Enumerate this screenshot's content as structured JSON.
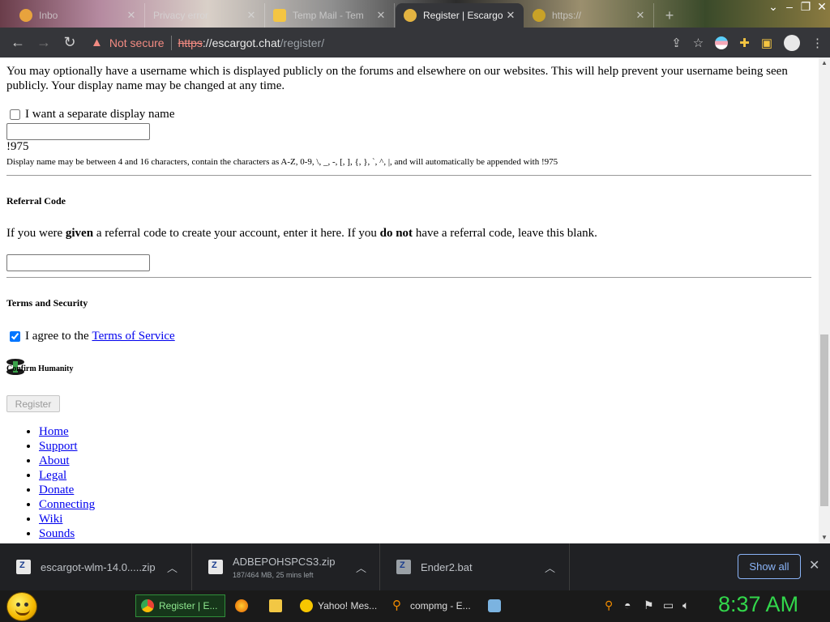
{
  "browser": {
    "tabs": [
      {
        "title": "Inbo"
      },
      {
        "title": "Privacy error"
      },
      {
        "title": "Temp Mail - Tem"
      },
      {
        "title": "Register | Escargo"
      },
      {
        "title": "https://"
      }
    ],
    "security_label": "Not secure",
    "url": {
      "scheme": "https",
      "host": "://escargot.chat",
      "path": "/register/"
    }
  },
  "page": {
    "intro": "You may optionally have a username which is displayed publicly on the forums and elsewhere on our websites. This will help prevent your username being seen publicly. Your display name may be changed at any time.",
    "display_name_checkbox": "I want a separate display name",
    "display_name_suffix": "!975",
    "display_name_hint": "Display name may be between 4 and 16 characters, contain the characters as A-Z, 0-9, \\, _, -, [, ], {, }, `, ^, |, and will automatically be appended with !975",
    "referral_heading": "Referral Code",
    "referral_text": {
      "a": "If you were ",
      "b": "given",
      "c": " a referral code to create your account, enter it here. If you ",
      "d": "do not",
      "e": " have a referral code, leave this blank."
    },
    "terms_heading": "Terms and Security",
    "agree_prefix": "I agree to the ",
    "terms_link": "Terms of Service",
    "terms_checked": true,
    "captcha_heading": "Confirm Humanity",
    "register_button": "Register",
    "footer_links": [
      "Home",
      "Support",
      "About",
      "Legal",
      "Donate",
      "Connecting",
      "Wiki",
      "Sounds"
    ]
  },
  "downloads": {
    "items": [
      {
        "name": "escargot-wlm-14.0.....zip",
        "status": ""
      },
      {
        "name": "ADBEPOHSPCS3.zip",
        "status": "187/464 MB, 25 mins left"
      },
      {
        "name": "Ender2.bat",
        "status": ""
      }
    ],
    "show_all": "Show all"
  },
  "taskbar": {
    "items": [
      "Register | E...",
      "Yahoo! Mes...",
      "compmg - E..."
    ],
    "clock": "8:37 AM"
  }
}
